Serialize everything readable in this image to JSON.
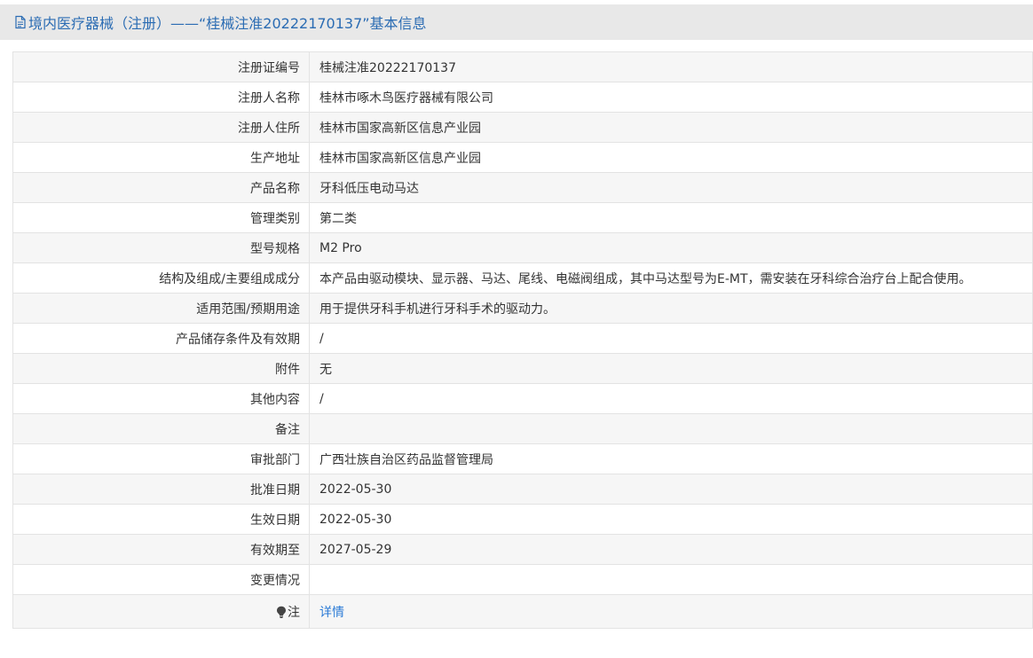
{
  "header": {
    "title": "境内医疗器械（注册）——“桂械注准20222170137”基本信息"
  },
  "rows": [
    {
      "label": "注册证编号",
      "value": "桂械注准20222170137"
    },
    {
      "label": "注册人名称",
      "value": "桂林市啄木鸟医疗器械有限公司"
    },
    {
      "label": "注册人住所",
      "value": "桂林市国家高新区信息产业园"
    },
    {
      "label": "生产地址",
      "value": "桂林市国家高新区信息产业园"
    },
    {
      "label": "产品名称",
      "value": "牙科低压电动马达"
    },
    {
      "label": "管理类别",
      "value": "第二类"
    },
    {
      "label": "型号规格",
      "value": "M2 Pro"
    },
    {
      "label": "结构及组成/主要组成成分",
      "value": "本产品由驱动模块、显示器、马达、尾线、电磁阀组成，其中马达型号为E-MT，需安装在牙科综合治疗台上配合使用。"
    },
    {
      "label": "适用范围/预期用途",
      "value": "用于提供牙科手机进行牙科手术的驱动力。"
    },
    {
      "label": "产品储存条件及有效期",
      "value": "/"
    },
    {
      "label": "附件",
      "value": "无"
    },
    {
      "label": "其他内容",
      "value": "/"
    },
    {
      "label": "备注",
      "value": ""
    },
    {
      "label": "审批部门",
      "value": "广西壮族自治区药品监督管理局"
    },
    {
      "label": "批准日期",
      "value": "2022-05-30"
    },
    {
      "label": "生效日期",
      "value": "2022-05-30"
    },
    {
      "label": "有效期至",
      "value": "2027-05-29"
    },
    {
      "label": "变更情况",
      "value": ""
    }
  ],
  "note": {
    "label": "注",
    "link_text": "详情",
    "icon": "lightbulb-icon"
  },
  "colors": {
    "title": "#2b6cb3",
    "link": "#2b7bd6",
    "header_bg": "#e8e8e8",
    "row_alt_bg": "#f6f6f6"
  }
}
